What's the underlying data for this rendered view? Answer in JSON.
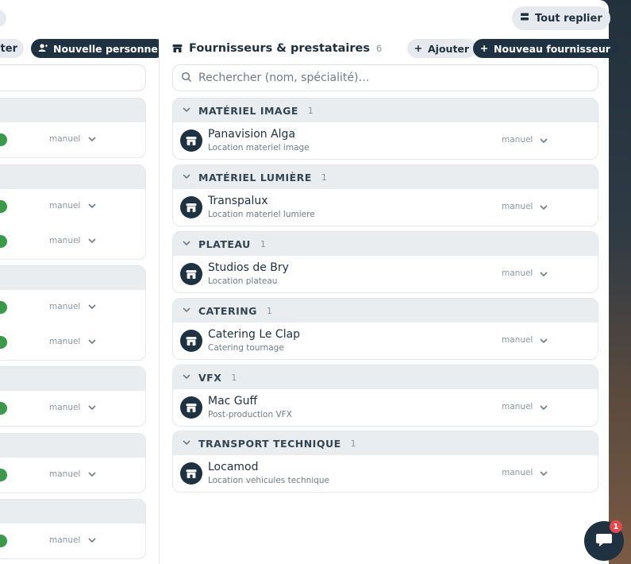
{
  "toolbar": {
    "collapse_all_label": "Tout replier"
  },
  "left_panel": {
    "add_label": "uter",
    "new_person_label": "Nouvelle personne",
    "rows": [
      {
        "mode": "manuel"
      },
      {
        "mode": "manuel"
      },
      {
        "mode": "manuel"
      },
      {
        "mode": "manuel"
      },
      {
        "mode": "manuel"
      },
      {
        "mode": "manuel"
      },
      {
        "mode": "manuel"
      },
      {
        "mode": "manuel"
      }
    ]
  },
  "suppliers": {
    "title": "Fournisseurs & prestataires",
    "count": "6",
    "add_label": "Ajouter",
    "new_label": "Nouveau fournisseur",
    "search_placeholder": "Rechercher (nom, spécialité)…",
    "groups": [
      {
        "name": "MATÉRIEL IMAGE",
        "count": "1",
        "items": [
          {
            "name": "Panavision Alga",
            "specialty": "Location materiel image",
            "mode": "manuel"
          }
        ]
      },
      {
        "name": "MATÉRIEL LUMIÈRE",
        "count": "1",
        "items": [
          {
            "name": "Transpalux",
            "specialty": "Location materiel lumiere",
            "mode": "manuel"
          }
        ]
      },
      {
        "name": "PLATEAU",
        "count": "1",
        "items": [
          {
            "name": "Studios de Bry",
            "specialty": "Location plateau",
            "mode": "manuel"
          }
        ]
      },
      {
        "name": "CATERING",
        "count": "1",
        "items": [
          {
            "name": "Catering Le Clap",
            "specialty": "Catering tournage",
            "mode": "manuel"
          }
        ]
      },
      {
        "name": "VFX",
        "count": "1",
        "items": [
          {
            "name": "Mac Guff",
            "specialty": "Post-production VFX",
            "mode": "manuel"
          }
        ]
      },
      {
        "name": "TRANSPORT TECHNIQUE",
        "count": "1",
        "items": [
          {
            "name": "Locamod",
            "specialty": "Location vehicules technique",
            "mode": "manuel"
          }
        ]
      }
    ]
  },
  "chat": {
    "badge_count": "1"
  },
  "icons": {
    "collapse": "collapse-icon",
    "person_add": "person-add-icon",
    "store": "store-icon",
    "plus": "plus-icon",
    "search": "search-icon",
    "chevron": "chevron-down-icon",
    "chat": "chat-icon"
  }
}
